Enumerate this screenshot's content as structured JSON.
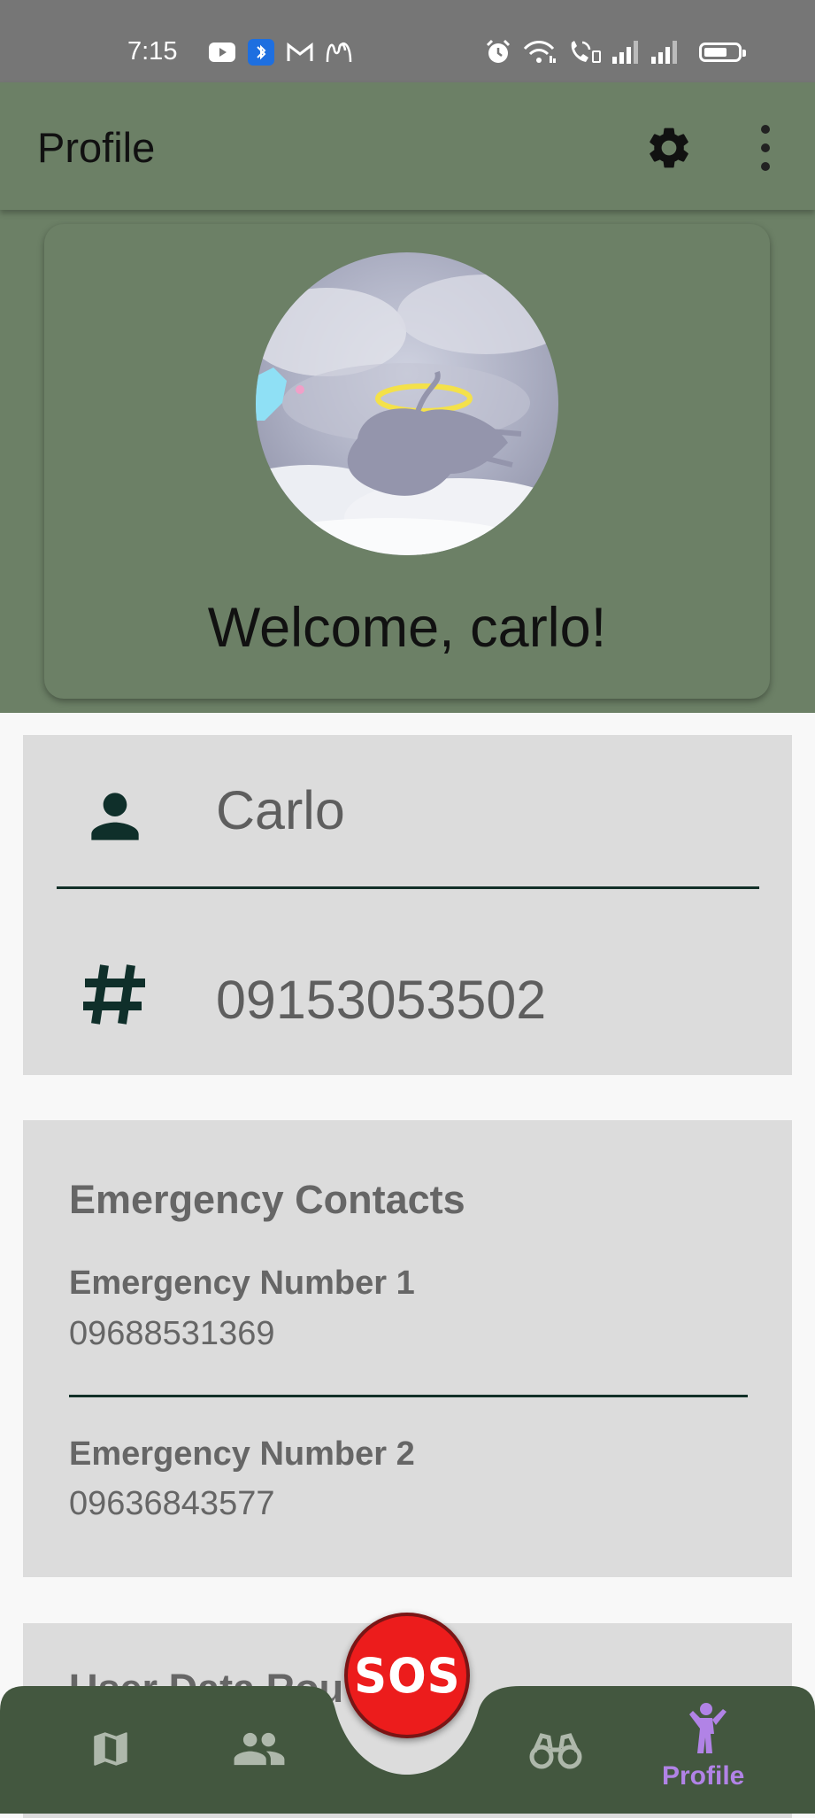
{
  "status_bar": {
    "time": "7:15",
    "left_icons": [
      "youtube-icon",
      "bluetooth-app-icon",
      "gmail-icon",
      "mcdonalds-icon"
    ],
    "right_icons": [
      "alarm-icon",
      "wifi-icon",
      "wifi-calling-icon",
      "signal-icon",
      "signal-icon",
      "battery-icon"
    ],
    "battery_level": 0.6
  },
  "app_bar": {
    "title": "Profile",
    "actions": [
      "gear-icon",
      "more-vert-icon"
    ]
  },
  "profile_card": {
    "welcome": "Welcome, carlo!"
  },
  "info_card": {
    "name": "Carlo",
    "phone": "09153053502"
  },
  "emergency": {
    "title": "Emergency Contacts",
    "contacts": [
      {
        "label": "Emergency Number 1",
        "number": "09688531369"
      },
      {
        "label": "Emergency Number 2",
        "number": "09636843577"
      }
    ]
  },
  "user_data": {
    "title": "User Data Rou"
  },
  "bottom_nav": {
    "sos_label": "SOS",
    "items": [
      {
        "icon": "map-icon",
        "label": ""
      },
      {
        "icon": "people-icon",
        "label": ""
      },
      {
        "icon": "binoculars-icon",
        "label": ""
      },
      {
        "icon": "person-walking-icon",
        "label": "Profile"
      }
    ],
    "active_item": "Profile"
  },
  "colors": {
    "status_bar": "#767676",
    "header_green": "#6c8066",
    "nav_green": "#43573f",
    "card_gray": "#dcdcdc",
    "divider": "#123028",
    "sos_red": "#ec1c1c",
    "active_purple": "#b183e6"
  }
}
